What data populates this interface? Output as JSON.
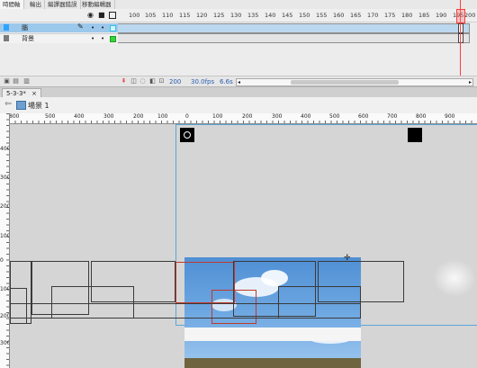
{
  "panel_tabs": [
    "時間軸",
    "輸出",
    "編譯器錯誤",
    "移動編輯器"
  ],
  "timeline": {
    "frame_numbers": [
      "100",
      "105",
      "110",
      "115",
      "120",
      "125",
      "130",
      "135",
      "140",
      "145",
      "150",
      "155",
      "160",
      "165",
      "170",
      "175",
      "180",
      "185",
      "190",
      "195",
      "200"
    ],
    "current_frame": "200",
    "fps": "30.0fps",
    "elapsed": "6.6s",
    "layers": [
      {
        "name": "腦",
        "selected": true,
        "outline_color": "#2ec5e5"
      },
      {
        "name": "背景",
        "selected": false,
        "outline_color": "#36d43a"
      }
    ]
  },
  "document": {
    "tab_label": "5-3-3*",
    "close_glyph": "×"
  },
  "scene": {
    "label": "場景 1"
  },
  "rulers": {
    "horizontal": [
      "800",
      "500",
      "400",
      "300",
      "200",
      "100",
      "0",
      "100",
      "200",
      "300",
      "400",
      "500",
      "600",
      "700",
      "800",
      "900"
    ],
    "vertical": [
      "400",
      "300",
      "200",
      "100",
      "0",
      "100",
      "200",
      "300"
    ]
  },
  "icons": {
    "eye": "eye-icon",
    "lock": "lock-icon",
    "outline": "outline-icon",
    "pencil": "pencil-icon",
    "layer": "layer-icon",
    "scene": "scene-icon"
  }
}
